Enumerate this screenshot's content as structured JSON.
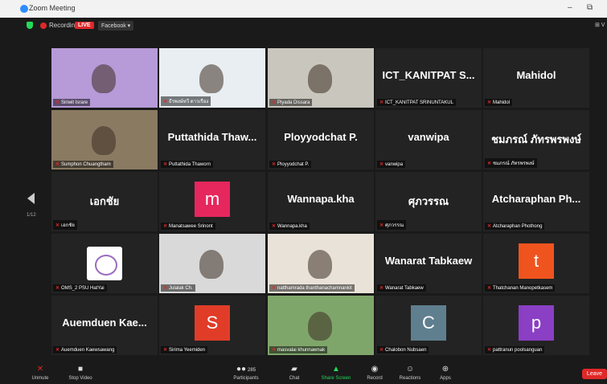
{
  "window": {
    "title": "Zoom Meeting",
    "minimize": "–",
    "restore": "⧉"
  },
  "topbar": {
    "recording": "Recording",
    "live": "LIVE",
    "stream_target": "Facebook ▾",
    "view": "⊞ V"
  },
  "nav": {
    "page": "1/12"
  },
  "tiles": [
    {
      "name": "",
      "label": "Siriwit Israre",
      "kind": "video",
      "bg": "#b79ad8"
    },
    {
      "name": "",
      "label": "ธีรพงษ์ทวี ดาวเรือง",
      "kind": "video",
      "bg": "#e8eef2"
    },
    {
      "name": "",
      "label": "Piyada Dissara",
      "kind": "video",
      "bg": "#c8c6bd"
    },
    {
      "name": "ICT_KANITPAT S...",
      "label": "ICT_KANITPAT SRINUNTAKUL",
      "kind": "name"
    },
    {
      "name": "Mahidol",
      "label": "Mahidol",
      "kind": "name"
    },
    {
      "name": "",
      "label": "Sumphon Chuangtham",
      "kind": "video",
      "bg": "#8a7a62"
    },
    {
      "name": "Puttathida Thaw...",
      "label": "Puttathida Thaworn",
      "kind": "name"
    },
    {
      "name": "Ployyodchat P.",
      "label": "Ployyodchat P.",
      "kind": "name"
    },
    {
      "name": "vanwipa",
      "label": "vanwipa",
      "kind": "name"
    },
    {
      "name": "ชมภรณ์ ภัทรพรพงษ์",
      "label": "ชมภรณ์ ภัทรพรพงษ์",
      "kind": "name"
    },
    {
      "name": "เอกชัย",
      "label": "เอกชัย",
      "kind": "name"
    },
    {
      "name": "m",
      "label": "Manatsawee Srinont",
      "kind": "avatar",
      "color": "#e5275d"
    },
    {
      "name": "Wannapa.kha",
      "label": "Wannapa.kha",
      "kind": "name"
    },
    {
      "name": "ศุภวรรณ",
      "label": "ศุภวรรณ",
      "kind": "name"
    },
    {
      "name": "Atcharaphan Ph...",
      "label": "Atcharaphan Phothong",
      "kind": "name"
    },
    {
      "name": "",
      "label": "OMS_2 PSU HatYai",
      "kind": "logo",
      "bg": "#ffffff"
    },
    {
      "name": "",
      "label": "Julalak Ch.",
      "kind": "video",
      "bg": "#d9d9d9"
    },
    {
      "name": "",
      "label": "natthamrada thanthanachamnankit",
      "kind": "video",
      "bg": "#e9e2d8"
    },
    {
      "name": "Wanarat Tabkaew",
      "label": "Wanarat Tabkaew",
      "kind": "name"
    },
    {
      "name": "t",
      "label": "Thatchanan Manopetkasem",
      "kind": "avatar",
      "color": "#f0541e"
    },
    {
      "name": "Auemduen Kae...",
      "label": "Auemduen Kaewsawang",
      "kind": "name"
    },
    {
      "name": "S",
      "label": "Sirima Yeemiden",
      "kind": "avatar",
      "color": "#e03c28"
    },
    {
      "name": "",
      "label": "masvalai khunnawnak",
      "kind": "video",
      "bg": "#7fa66a"
    },
    {
      "name": "C",
      "label": "Chalobon Nubsaen",
      "kind": "avatar",
      "color": "#5f7f8f"
    },
    {
      "name": "p",
      "label": "pattranun poolsanguan",
      "kind": "avatar",
      "color": "#8a3fc4"
    }
  ],
  "toolbar": {
    "unmute": "Unmute",
    "stop_video": "Stop Video",
    "participants": "Participants",
    "participants_count": "285",
    "chat": "Chat",
    "share_screen": "Share Screen",
    "record": "Record",
    "reactions": "Reactions",
    "apps": "Apps",
    "leave": "Leave"
  },
  "colors": {
    "active_speaker": "#b4e63c",
    "live": "#e02828",
    "share": "#23d959"
  }
}
